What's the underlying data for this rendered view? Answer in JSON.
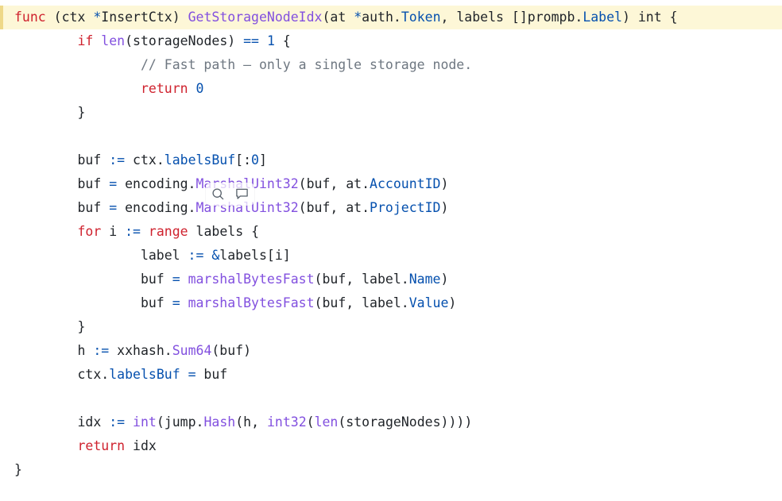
{
  "view": {
    "name": "code-file-viewer",
    "language": "Go",
    "background": "#ffffff",
    "highlight_background": "#fdf7d7",
    "highlight_border": "#eed888"
  },
  "colors": {
    "keyword": "#cf222e",
    "function": "#8250df",
    "identifier": "#0550ae",
    "number": "#0550ae",
    "operator": "#0550ae",
    "comment": "#6e7781",
    "plain": "#1f2328"
  },
  "clipped_top_line": "",
  "code": {
    "lines": [
      {
        "id": "line-func-signature",
        "highlighted": true,
        "tokens": [
          {
            "t": "func",
            "c": "kw"
          },
          {
            "t": " (ctx ",
            "c": "pl"
          },
          {
            "t": "*",
            "c": "id"
          },
          {
            "t": "InsertCtx) ",
            "c": "pl"
          },
          {
            "t": "GetStorageNodeIdx",
            "c": "fn"
          },
          {
            "t": "(at ",
            "c": "pl"
          },
          {
            "t": "*",
            "c": "id"
          },
          {
            "t": "auth.",
            "c": "pl"
          },
          {
            "t": "Token",
            "c": "id"
          },
          {
            "t": ", labels []prompb.",
            "c": "pl"
          },
          {
            "t": "Label",
            "c": "id"
          },
          {
            "t": ") ",
            "c": "pl"
          },
          {
            "t": "int",
            "c": "pl"
          },
          {
            "t": " {",
            "c": "pl"
          }
        ]
      },
      {
        "id": "line-if-len",
        "highlighted": false,
        "tokens": [
          {
            "t": "        ",
            "c": "pl"
          },
          {
            "t": "if",
            "c": "kw"
          },
          {
            "t": " ",
            "c": "pl"
          },
          {
            "t": "len",
            "c": "fn"
          },
          {
            "t": "(storageNodes) ",
            "c": "pl"
          },
          {
            "t": "==",
            "c": "op"
          },
          {
            "t": " ",
            "c": "pl"
          },
          {
            "t": "1",
            "c": "num"
          },
          {
            "t": " {",
            "c": "pl"
          }
        ]
      },
      {
        "id": "line-comment-fastpath",
        "highlighted": false,
        "tokens": [
          {
            "t": "                ",
            "c": "pl"
          },
          {
            "t": "// Fast path – only a single storage node.",
            "c": "cm"
          }
        ]
      },
      {
        "id": "line-return-zero",
        "highlighted": false,
        "tokens": [
          {
            "t": "                ",
            "c": "pl"
          },
          {
            "t": "return",
            "c": "kw"
          },
          {
            "t": " ",
            "c": "pl"
          },
          {
            "t": "0",
            "c": "num"
          }
        ]
      },
      {
        "id": "line-close-if",
        "highlighted": false,
        "tokens": [
          {
            "t": "        }",
            "c": "pl"
          }
        ]
      },
      {
        "id": "line-blank-1",
        "highlighted": false,
        "tokens": [
          {
            "t": "",
            "c": "pl"
          }
        ]
      },
      {
        "id": "line-buf-init",
        "highlighted": false,
        "tokens": [
          {
            "t": "        buf ",
            "c": "pl"
          },
          {
            "t": ":=",
            "c": "op"
          },
          {
            "t": " ctx.",
            "c": "pl"
          },
          {
            "t": "labelsBuf",
            "c": "id"
          },
          {
            "t": "[:",
            "c": "pl"
          },
          {
            "t": "0",
            "c": "num"
          },
          {
            "t": "]",
            "c": "pl"
          }
        ]
      },
      {
        "id": "line-marshal-accountid",
        "highlighted": false,
        "tokens": [
          {
            "t": "        buf ",
            "c": "pl"
          },
          {
            "t": "=",
            "c": "op"
          },
          {
            "t": " encoding.",
            "c": "pl"
          },
          {
            "t": "MarshalUint32",
            "c": "fn"
          },
          {
            "t": "(buf, at.",
            "c": "pl"
          },
          {
            "t": "AccountID",
            "c": "id"
          },
          {
            "t": ")",
            "c": "pl"
          }
        ]
      },
      {
        "id": "line-marshal-projectid",
        "highlighted": false,
        "tokens": [
          {
            "t": "        buf ",
            "c": "pl"
          },
          {
            "t": "=",
            "c": "op"
          },
          {
            "t": " encoding.",
            "c": "pl"
          },
          {
            "t": "MarshalUint32",
            "c": "fn"
          },
          {
            "t": "(buf, at.",
            "c": "pl"
          },
          {
            "t": "ProjectID",
            "c": "id"
          },
          {
            "t": ")",
            "c": "pl"
          }
        ]
      },
      {
        "id": "line-for-range",
        "highlighted": false,
        "tokens": [
          {
            "t": "        ",
            "c": "pl"
          },
          {
            "t": "for",
            "c": "kw"
          },
          {
            "t": " i ",
            "c": "pl"
          },
          {
            "t": ":=",
            "c": "op"
          },
          {
            "t": " ",
            "c": "pl"
          },
          {
            "t": "range",
            "c": "kw"
          },
          {
            "t": " labels {",
            "c": "pl"
          }
        ]
      },
      {
        "id": "line-label-assign",
        "highlighted": false,
        "tokens": [
          {
            "t": "                label ",
            "c": "pl"
          },
          {
            "t": ":=",
            "c": "op"
          },
          {
            "t": " ",
            "c": "pl"
          },
          {
            "t": "&",
            "c": "id"
          },
          {
            "t": "labels[i]",
            "c": "pl"
          }
        ]
      },
      {
        "id": "line-marshal-name",
        "highlighted": false,
        "tokens": [
          {
            "t": "                buf ",
            "c": "pl"
          },
          {
            "t": "=",
            "c": "op"
          },
          {
            "t": " ",
            "c": "pl"
          },
          {
            "t": "marshalBytesFast",
            "c": "fn"
          },
          {
            "t": "(buf, label.",
            "c": "pl"
          },
          {
            "t": "Name",
            "c": "id"
          },
          {
            "t": ")",
            "c": "pl"
          }
        ]
      },
      {
        "id": "line-marshal-value",
        "highlighted": false,
        "tokens": [
          {
            "t": "                buf ",
            "c": "pl"
          },
          {
            "t": "=",
            "c": "op"
          },
          {
            "t": " ",
            "c": "pl"
          },
          {
            "t": "marshalBytesFast",
            "c": "fn"
          },
          {
            "t": "(buf, label.",
            "c": "pl"
          },
          {
            "t": "Value",
            "c": "id"
          },
          {
            "t": ")",
            "c": "pl"
          }
        ]
      },
      {
        "id": "line-close-for",
        "highlighted": false,
        "tokens": [
          {
            "t": "        }",
            "c": "pl"
          }
        ]
      },
      {
        "id": "line-hash-sum64",
        "highlighted": false,
        "tokens": [
          {
            "t": "        h ",
            "c": "pl"
          },
          {
            "t": ":=",
            "c": "op"
          },
          {
            "t": " xxhash.",
            "c": "pl"
          },
          {
            "t": "Sum64",
            "c": "fn"
          },
          {
            "t": "(buf)",
            "c": "pl"
          }
        ]
      },
      {
        "id": "line-store-labelsbuf",
        "highlighted": false,
        "tokens": [
          {
            "t": "        ctx.",
            "c": "pl"
          },
          {
            "t": "labelsBuf",
            "c": "id"
          },
          {
            "t": " ",
            "c": "pl"
          },
          {
            "t": "=",
            "c": "op"
          },
          {
            "t": " buf",
            "c": "pl"
          }
        ]
      },
      {
        "id": "line-blank-2",
        "highlighted": false,
        "tokens": [
          {
            "t": "",
            "c": "pl"
          }
        ]
      },
      {
        "id": "line-idx-jump-hash",
        "highlighted": false,
        "tokens": [
          {
            "t": "        idx ",
            "c": "pl"
          },
          {
            "t": ":=",
            "c": "op"
          },
          {
            "t": " ",
            "c": "pl"
          },
          {
            "t": "int",
            "c": "fn"
          },
          {
            "t": "(jump.",
            "c": "pl"
          },
          {
            "t": "Hash",
            "c": "fn"
          },
          {
            "t": "(h, ",
            "c": "pl"
          },
          {
            "t": "int32",
            "c": "fn"
          },
          {
            "t": "(",
            "c": "pl"
          },
          {
            "t": "len",
            "c": "fn"
          },
          {
            "t": "(storageNodes))))",
            "c": "pl"
          }
        ]
      },
      {
        "id": "line-return-idx",
        "highlighted": false,
        "tokens": [
          {
            "t": "        ",
            "c": "pl"
          },
          {
            "t": "return",
            "c": "kw"
          },
          {
            "t": " idx",
            "c": "pl"
          }
        ]
      },
      {
        "id": "line-close-func",
        "highlighted": false,
        "tokens": [
          {
            "t": "}",
            "c": "pl"
          }
        ]
      }
    ]
  },
  "selection_popup": {
    "visible": true,
    "buttons": [
      {
        "id": "search-icon",
        "label": "Search"
      },
      {
        "id": "comment-icon",
        "label": "Comment"
      }
    ]
  }
}
